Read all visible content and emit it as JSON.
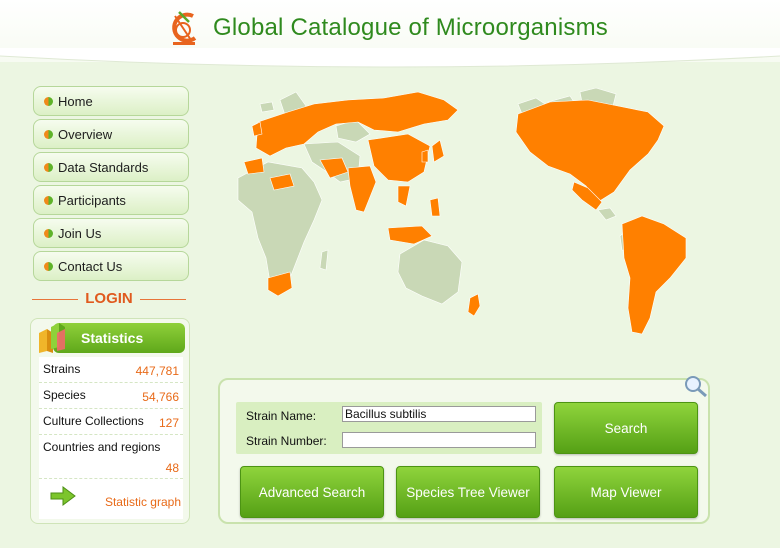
{
  "header": {
    "title": "Global Catalogue of Microorganisms"
  },
  "nav": {
    "items": [
      {
        "label": "Home"
      },
      {
        "label": "Overview"
      },
      {
        "label": "Data Standards"
      },
      {
        "label": "Participants"
      },
      {
        "label": "Join Us"
      },
      {
        "label": "Contact Us"
      }
    ]
  },
  "login": {
    "label": "LOGIN"
  },
  "statistics": {
    "title": "Statistics",
    "rows": [
      {
        "label": "Strains",
        "value": "447,781"
      },
      {
        "label": "Species",
        "value": "54,766"
      },
      {
        "label": "Culture Collections",
        "value": "127"
      },
      {
        "label": "Countries and regions",
        "value": "48"
      }
    ],
    "graph_label": "Statistic graph"
  },
  "search": {
    "strain_name_label": "Strain Name:",
    "strain_name_value": "Bacillus subtilis",
    "strain_number_label": "Strain Number:",
    "strain_number_value": "",
    "search_button": "Search",
    "advanced_search_button": "Advanced  Search",
    "species_tree_button": "Species Tree Viewer",
    "map_viewer_button": "Map Viewer"
  },
  "colors": {
    "brand_green": "#2f8a1e",
    "accent_orange": "#e86a18",
    "participant_country": "#ff8000",
    "other_country": "#c9d8b6"
  }
}
